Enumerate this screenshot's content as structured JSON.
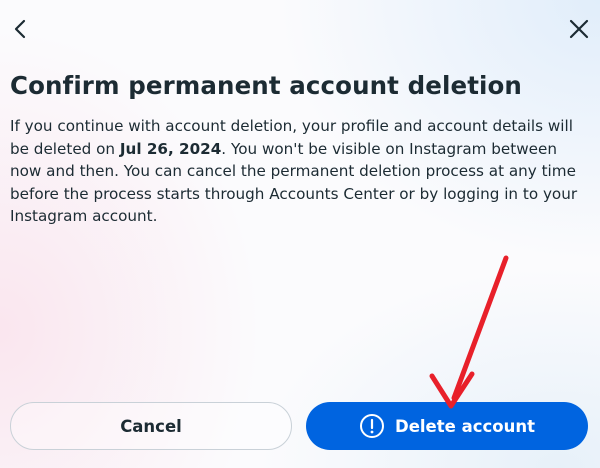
{
  "header": {
    "back_icon": "chevron-left-icon",
    "close_icon": "close-icon"
  },
  "dialog": {
    "title": "Confirm permanent account deletion",
    "body_before_date": "If you continue with account deletion, your profile and account details will be deleted on ",
    "deletion_date": "Jul 26, 2024",
    "body_after_date": ". You won't be visible on Instagram between now and then. You can cancel the permanent deletion process at any time before the process starts through Accounts Center or by logging in to your Instagram account."
  },
  "actions": {
    "cancel_label": "Cancel",
    "delete_label": "Delete account",
    "delete_icon": "alert-circle-icon",
    "primary_color": "#0064e0"
  },
  "annotation": {
    "arrow_color": "#e8202a"
  }
}
